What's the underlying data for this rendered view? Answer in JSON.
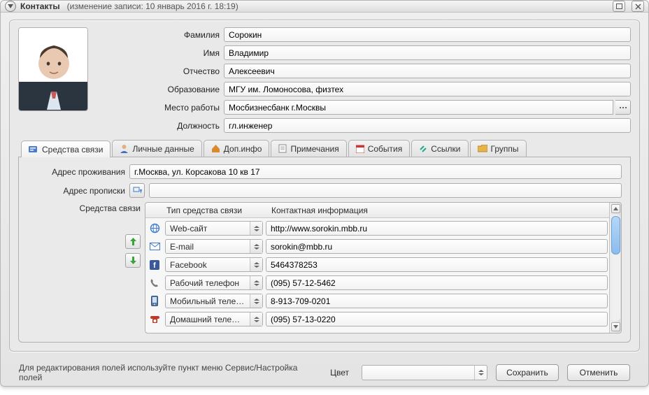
{
  "title": {
    "app": "Контакты",
    "modified": "(изменение записи: 10 январь 2016 г. 18:19)"
  },
  "fields": {
    "surname": {
      "label": "Фамилия",
      "value": "Сорокин"
    },
    "name": {
      "label": "Имя",
      "value": "Владимир"
    },
    "patronym": {
      "label": "Отчество",
      "value": "Алексеевич"
    },
    "education": {
      "label": "Образование",
      "value": "МГУ им. Ломоносова, физтех"
    },
    "work": {
      "label": "Место работы",
      "value": "Мосбизнесбанк г.Москвы"
    },
    "position": {
      "label": "Должность",
      "value": "гл.инженер"
    }
  },
  "tabs": {
    "comm": {
      "label": "Средства связи"
    },
    "personal": {
      "label": "Личные данные"
    },
    "extra": {
      "label": "Доп.инфо"
    },
    "notes": {
      "label": "Примечания"
    },
    "events": {
      "label": "События"
    },
    "links": {
      "label": "Ссылки"
    },
    "groups": {
      "label": "Группы"
    }
  },
  "addr": {
    "live": {
      "label": "Адрес проживания",
      "value": "г.Москва, ул. Корсакова 10 кв 17"
    },
    "reg": {
      "label": "Адрес прописки",
      "value": ""
    },
    "comm": {
      "label": "Средства связи"
    }
  },
  "comm_head": {
    "type": "Тип средства связи",
    "info": "Контактная информация"
  },
  "comm_rows": [
    {
      "icon": "globe",
      "type": "Web-сайт",
      "value": "http://www.sorokin.mbb.ru"
    },
    {
      "icon": "mail",
      "type": "E-mail",
      "value": "sorokin@mbb.ru"
    },
    {
      "icon": "fb",
      "type": "Facebook",
      "value": "5464378253"
    },
    {
      "icon": "phone",
      "type": "Рабочий телефон",
      "value": "(095) 57-12-5462"
    },
    {
      "icon": "mobile",
      "type": "Мобильный телефон",
      "value": "8-913-709-0201"
    },
    {
      "icon": "homeph",
      "type": "Домашний телефон",
      "value": "(095) 57-13-0220"
    }
  ],
  "footer": {
    "hint": "Для редактирования полей используйте пункт меню Сервис/Настройка полей",
    "color_label": "Цвет",
    "save": "Сохранить",
    "cancel": "Отменить"
  }
}
